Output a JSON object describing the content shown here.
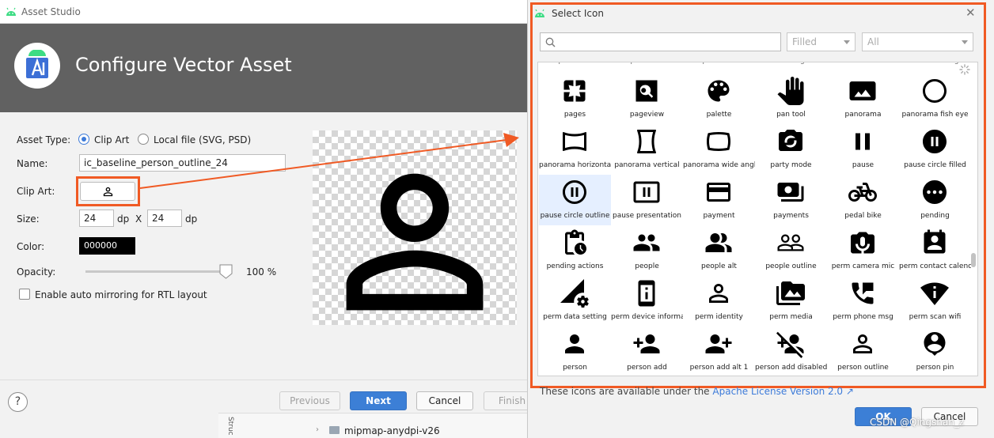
{
  "asset_studio": {
    "window_title": "Asset Studio",
    "header_title": "Configure Vector Asset",
    "asset_type_label": "Asset Type:",
    "asset_type_options": [
      "Clip Art",
      "Local file (SVG, PSD)"
    ],
    "asset_type_selected": "Clip Art",
    "name_label": "Name:",
    "name_value": "ic_baseline_person_outline_24",
    "clip_art_label": "Clip Art:",
    "size_label": "Size:",
    "width_value": "24",
    "height_value": "24",
    "unit": "dp",
    "size_separator": "X",
    "color_label": "Color:",
    "color_value": "000000",
    "opacity_label": "Opacity:",
    "opacity_value": "100 %",
    "opacity_fraction": 1.0,
    "rtl_label": "Enable auto mirroring for RTL layout",
    "rtl_checked": false,
    "help_label": "?",
    "buttons": {
      "previous": "Previous",
      "next": "Next",
      "cancel": "Cancel",
      "finish": "Finish"
    }
  },
  "ide": {
    "tree_item": "mipmap-anydpi-v26",
    "side_tab": "Struc"
  },
  "select_icon": {
    "title": "Select Icon",
    "search_placeholder": "",
    "style_select": "Filled",
    "category_select": "All",
    "partial_row": [
      "open in full",
      "open in new",
      "open with",
      "outdoor grill",
      "outlet",
      "outlined flag"
    ],
    "icons": [
      {
        "label": "pages",
        "icon": "pages-icon"
      },
      {
        "label": "pageview",
        "icon": "pageview-icon"
      },
      {
        "label": "palette",
        "icon": "palette-icon"
      },
      {
        "label": "pan tool",
        "icon": "pan-tool-icon"
      },
      {
        "label": "panorama",
        "icon": "panorama-icon"
      },
      {
        "label": "panorama fish eye",
        "icon": "panorama-fish-eye-icon"
      },
      {
        "label": "panorama horizonta",
        "icon": "panorama-horizontal-icon"
      },
      {
        "label": "panorama vertical",
        "icon": "panorama-vertical-icon"
      },
      {
        "label": "panorama wide angl",
        "icon": "panorama-wide-angle-icon"
      },
      {
        "label": "party mode",
        "icon": "party-mode-icon"
      },
      {
        "label": "pause",
        "icon": "pause-icon"
      },
      {
        "label": "pause circle filled",
        "icon": "pause-circle-filled-icon"
      },
      {
        "label": "pause circle outline",
        "icon": "pause-circle-outline-icon"
      },
      {
        "label": "pause presentation",
        "icon": "pause-presentation-icon"
      },
      {
        "label": "payment",
        "icon": "payment-icon"
      },
      {
        "label": "payments",
        "icon": "payments-icon"
      },
      {
        "label": "pedal bike",
        "icon": "pedal-bike-icon"
      },
      {
        "label": "pending",
        "icon": "pending-icon"
      },
      {
        "label": "pending actions",
        "icon": "pending-actions-icon"
      },
      {
        "label": "people",
        "icon": "people-icon"
      },
      {
        "label": "people alt",
        "icon": "people-alt-icon"
      },
      {
        "label": "people outline",
        "icon": "people-outline-icon"
      },
      {
        "label": "perm camera mic",
        "icon": "perm-camera-mic-icon"
      },
      {
        "label": "perm contact calenc",
        "icon": "perm-contact-calendar-icon"
      },
      {
        "label": "perm data setting",
        "icon": "perm-data-setting-icon"
      },
      {
        "label": "perm device informa",
        "icon": "perm-device-information-icon"
      },
      {
        "label": "perm identity",
        "icon": "perm-identity-icon"
      },
      {
        "label": "perm media",
        "icon": "perm-media-icon"
      },
      {
        "label": "perm phone msg",
        "icon": "perm-phone-msg-icon"
      },
      {
        "label": "perm scan wifi",
        "icon": "perm-scan-wifi-icon"
      },
      {
        "label": "person",
        "icon": "person-icon"
      },
      {
        "label": "person add",
        "icon": "person-add-icon"
      },
      {
        "label": "person add alt 1",
        "icon": "person-add-alt-1-icon"
      },
      {
        "label": "person add disabled",
        "icon": "person-add-disabled-icon"
      },
      {
        "label": "person outline",
        "icon": "person-outline-icon"
      },
      {
        "label": "person pin",
        "icon": "person-pin-icon"
      }
    ],
    "selected_icon": "pause circle outline",
    "license_text": "These icons are available under the",
    "license_link": "Apache License Version 2.0 ↗",
    "ok": "OK",
    "cancel": "Cancel"
  },
  "watermark": "CSDN @Qingshan_z",
  "colors": {
    "accent": "#3d7bd9",
    "header": "#616161",
    "annotation": "#f05a24"
  }
}
